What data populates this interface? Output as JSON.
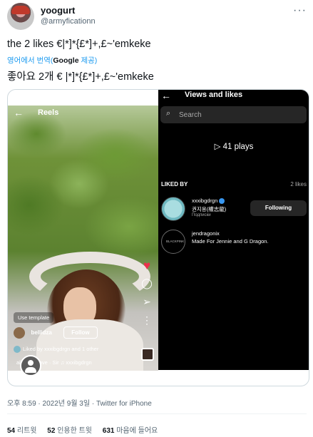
{
  "author": {
    "display_name": "yoogurt",
    "handle": "@armyficationn"
  },
  "more_icon": "ellipsis-icon",
  "tweet": {
    "text": "the 2 likes €|*]*{£*]+,£~'emkeke",
    "translate_prefix": "영어에서 번역(",
    "translate_google": "Google",
    "translate_suffix": " 제공)",
    "translated_text": "좋아요 2개 € |*]*{£*]+,£~'emkeke"
  },
  "reel": {
    "back_icon": "arrow-left-icon",
    "title": "Reels",
    "use_template": "Use template",
    "username": "bellidza",
    "follow_label": "Follow",
    "liked_by_text": "Liked by xxxibgdrgn and 1 other",
    "music_text": "alling in Love · Sir  ♫  xxxibgdrgn",
    "side_icons": [
      "heart-icon",
      "comment-icon",
      "send-icon",
      "more-icon"
    ]
  },
  "views_panel": {
    "title": "Views and likes",
    "search_placeholder": "Search",
    "plays": "▷ 41 plays",
    "liked_by_label": "LIKED BY",
    "likes_count": "2 likes",
    "likers": [
      {
        "username": "xxxibgdrgn",
        "subtitle": "권지용(權志龍)",
        "subtitle2": "Подписки",
        "button": "Following",
        "verified": true
      },
      {
        "username": "jendragonix",
        "subtitle": "Made For Jennie and G Dragon.",
        "avatar_text": "BLACKPINK"
      }
    ]
  },
  "footer": {
    "meta": "오후 8:59 · 2022년 9월 3일 · Twitter for iPhone",
    "retweets_count": "54",
    "retweets_label": "리트윗",
    "quotes_count": "52",
    "quotes_label": "인용한 트윗",
    "likes_count": "631",
    "likes_label": "마음에 들어요"
  }
}
